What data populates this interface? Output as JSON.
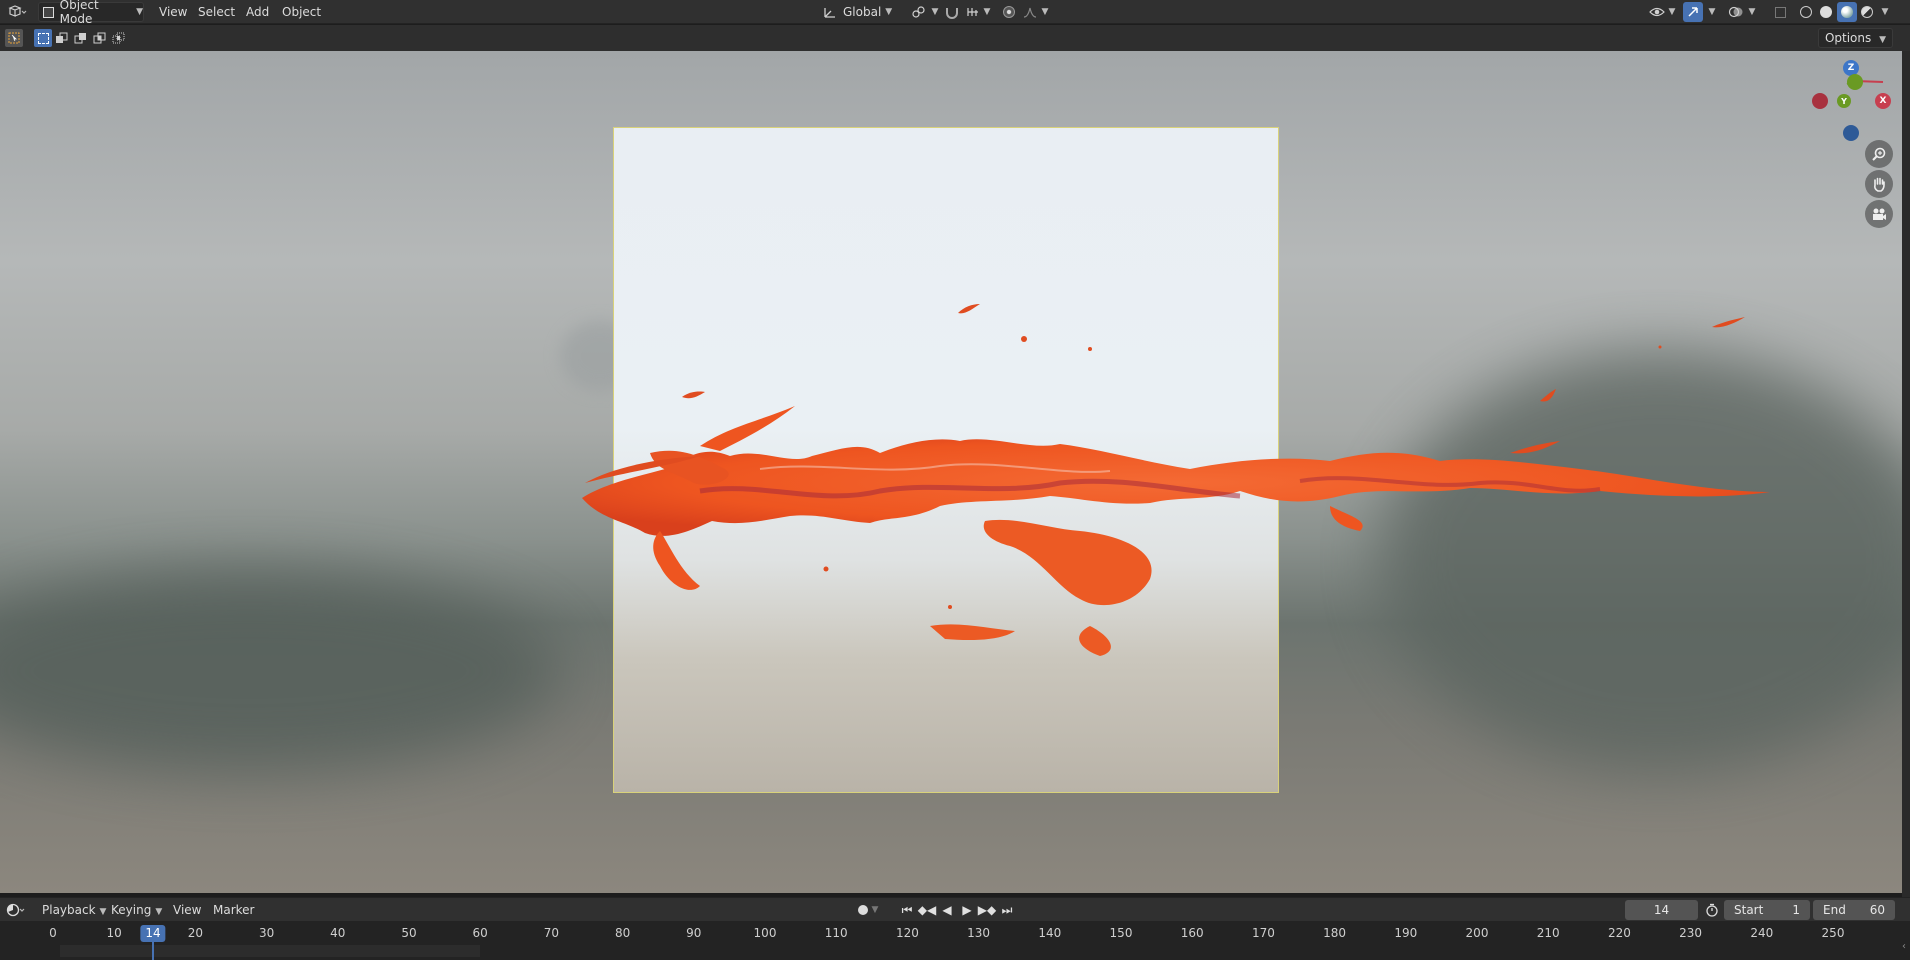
{
  "header": {
    "mode_label": "Object Mode",
    "menus": [
      "View",
      "Select",
      "Add",
      "Object"
    ],
    "transform_orientation": "Global"
  },
  "toolrow": {
    "options_label": "Options"
  },
  "gizmo": {
    "z": "Z",
    "y": "Y",
    "x": "X"
  },
  "timeline": {
    "menus": [
      "Playback",
      "Keying",
      "View",
      "Marker"
    ],
    "current_frame": "14",
    "start_label": "Start",
    "start_value": "1",
    "end_label": "End",
    "end_value": "60",
    "ticks": [
      "0",
      "10",
      "20",
      "30",
      "40",
      "50",
      "60",
      "70",
      "80",
      "90",
      "100",
      "110",
      "120",
      "130",
      "140",
      "150",
      "160",
      "170",
      "180",
      "190",
      "200",
      "210",
      "220",
      "230",
      "240",
      "250"
    ]
  },
  "colors": {
    "accent": "#4772b3",
    "x_axis": "#c73f4f",
    "y_axis": "#6a9a23",
    "z_axis": "#3d76c8",
    "splash": "#f05a22"
  }
}
